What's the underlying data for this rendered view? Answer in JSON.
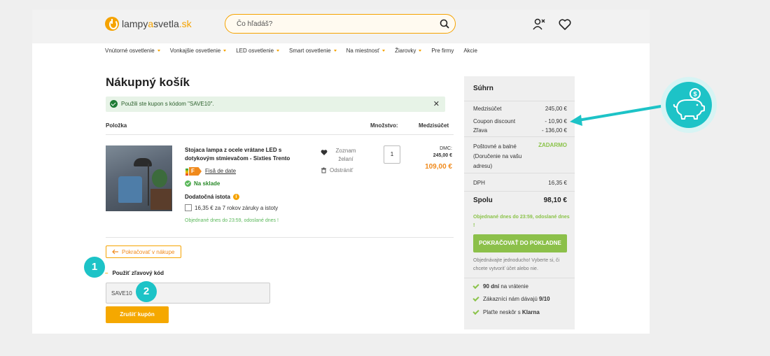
{
  "brand": {
    "logo_part1": "lampy",
    "logo_accent": "a",
    "logo_part2": "svetla",
    "logo_tld": ".sk",
    "accent": "#f5a300",
    "teal": "#1dc3c7",
    "green": "#8bc34a"
  },
  "search": {
    "placeholder": "Čo hľadáš?"
  },
  "nav": [
    "Vnútorné osvetlenie",
    "Vonkajšie osvetlenie",
    "LED osvetlenie",
    "Smart osvetlenie",
    "Na miestnosť",
    "Žiarovky",
    "Pre firmy",
    "Akcie"
  ],
  "cart": {
    "title": "Nákupný košík",
    "alert": "Použili ste kupon s kódom \"SAVE10\".",
    "alert_close": "✕",
    "col_item": "Položka",
    "col_qty": "Množstvo:",
    "col_subtotal": "Medzisúčet",
    "product": {
      "name": "Stojaca lampa z ocele vrátane LED s dotykovým stmievačom - Sixties Trento",
      "energy_class": "F",
      "datasheet": "Fisă de date",
      "stock": "Na sklade",
      "extra_title": "Dodatočná istota",
      "info": "i",
      "warranty": "16,35 € za 7 rokov záruky a istoty",
      "ship_note": "Objednané dnes do 23:59, odoslané dnes !",
      "wishlist": "Zoznam želaní",
      "remove": "Odstrániť",
      "qty": "1",
      "dmc_label": "DMC:",
      "dmc_value": "245,00 €",
      "price": "109,00 €"
    },
    "continue": "Pokračovať v nákupe",
    "coupon_label": "Použiť zľavový kód",
    "coupon_dash": "–",
    "coupon_value": "SAVE10",
    "cancel_coupon": "Zrušiť kupón",
    "badge1": "1",
    "badge2": "2"
  },
  "summary": {
    "title": "Súhrn",
    "rows": [
      {
        "label": "Medzisúčet",
        "value": "245,00 €"
      },
      {
        "label": "Coupon discount",
        "value": "- 10,90 €"
      },
      {
        "label": "Zľava",
        "value": "- 136,00 €"
      }
    ],
    "shipping_label": "Poštovné a balné (Doručenie na vašu adresu)",
    "shipping_value": "ZADARMO",
    "vat_label": "DPH",
    "vat_value": "16,35 €",
    "total_label": "Spolu",
    "total_value": "98,10 €",
    "ship_note": "Objednané dnes do 23:59, odoslané dnes !",
    "checkout": "POKRAČOVAŤ DO POKLADNE",
    "guest_note": "Objednávajte jednoducho! Vyberte si, či chcete vytvoriť účet alebo nie.",
    "usp1_bold": "90 dní",
    "usp1_rest": " na vrátenie",
    "usp2_rest": "Zákazníci nám dávajú ",
    "usp2_bold": "9/10",
    "usp3_rest": "Plaťte neskôr s ",
    "usp3_bold": "Klarna"
  }
}
